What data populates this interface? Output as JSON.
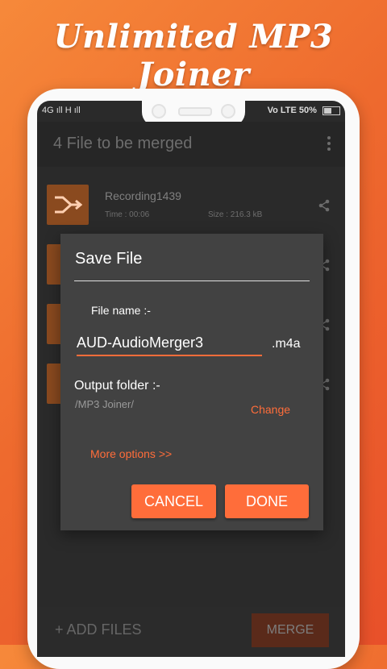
{
  "promo": {
    "title": "Unlimited MP3 Joiner"
  },
  "status_bar": {
    "left": "4G ıll  H ıll",
    "right": "Vo LTE  50%"
  },
  "app_bar": {
    "title": "4 File to be merged"
  },
  "files": [
    {
      "name": "Recording1439",
      "time": "Time : 00:06",
      "size": "Size : 216.3 kB"
    },
    {
      "name": "",
      "time": "",
      "size": ""
    },
    {
      "name": "",
      "time": "",
      "size": ""
    },
    {
      "name": "",
      "time": "",
      "size": ""
    }
  ],
  "bottom_bar": {
    "add_files": "+  ADD FILES",
    "merge": "MERGE"
  },
  "dialog": {
    "title": "Save File",
    "file_name_label": "File name :-",
    "file_name_value": "AUD-AudioMerger3",
    "extension": ".m4a",
    "output_folder_label": "Output folder :-",
    "output_folder_path": "/MP3 Joiner/",
    "change_label": "Change",
    "more_options_label": "More options >>",
    "cancel_label": "CANCEL",
    "done_label": "DONE"
  },
  "colors": {
    "accent": "#ff6d3a",
    "dialog_bg": "#424242"
  }
}
